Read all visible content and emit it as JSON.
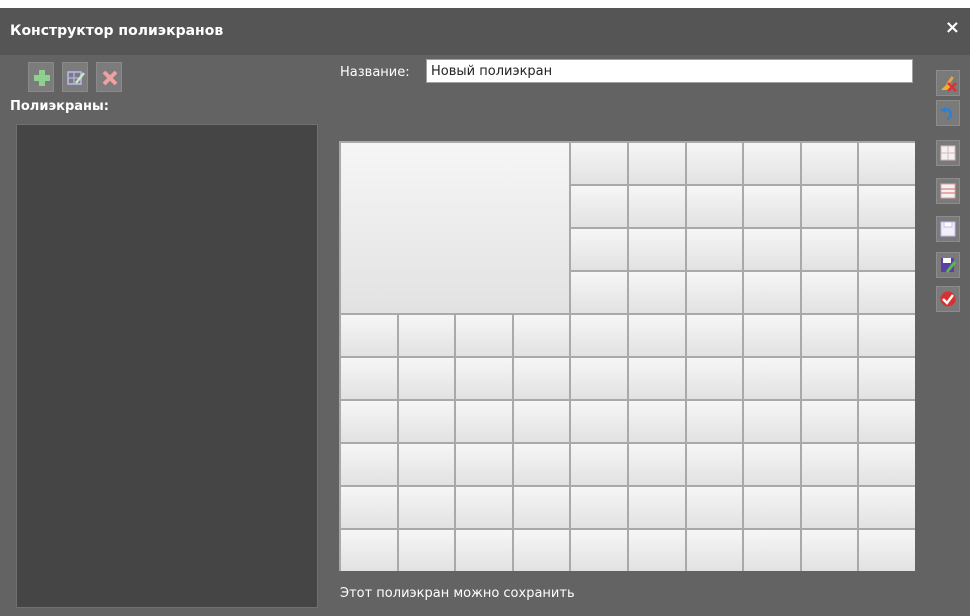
{
  "window": {
    "title": "Конструктор полиэкранов",
    "close_glyph": "×"
  },
  "toolbar": {
    "add_icon": "plus-icon",
    "edit_icon": "edit-layout-icon",
    "delete_icon": "delete-icon"
  },
  "sidebar": {
    "list_label": "Полиэкраны:",
    "items": []
  },
  "editor": {
    "name_label": "Название:",
    "name_value": "Новый полиэкран",
    "layout": {
      "columns": 10,
      "rows": 10,
      "merged_cells": [
        {
          "col": 0,
          "row": 0,
          "colspan": 4,
          "rowspan": 4
        }
      ]
    },
    "status": "Этот полиэкран можно сохранить"
  },
  "side_toolbar": [
    "clear-icon",
    "undo-icon",
    "merge-cells-icon",
    "split-cells-icon",
    "save-icon",
    "save-as-icon",
    "apply-icon"
  ]
}
